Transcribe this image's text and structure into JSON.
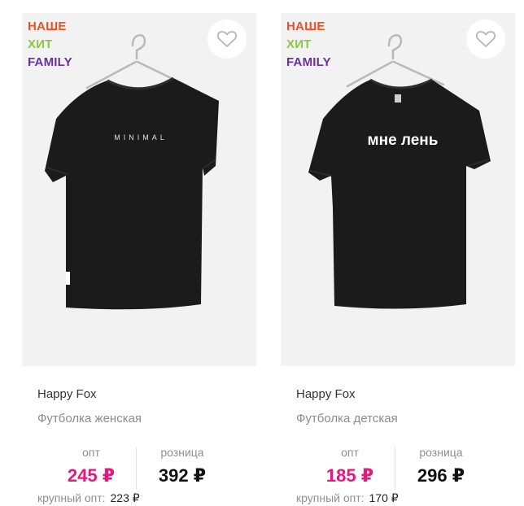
{
  "products": [
    {
      "badges": [
        {
          "text": "НАШЕ",
          "color": "#f04e23"
        },
        {
          "text": "ХИТ",
          "color": "#8dc63f"
        },
        {
          "text": "FAMILY",
          "color": "#6b2fa0"
        }
      ],
      "print_text": "MINIMAL",
      "brand": "Happy Fox",
      "title": "Футболка женская",
      "opt_label": "опт",
      "opt_price": "245 ₽",
      "retail_label": "розница",
      "retail_price": "392 ₽",
      "bulk_label": "крупный опт:",
      "bulk_price": "223 ₽"
    },
    {
      "badges": [
        {
          "text": "НАШЕ",
          "color": "#f04e23"
        },
        {
          "text": "ХИТ",
          "color": "#8dc63f"
        },
        {
          "text": "FAMILY",
          "color": "#6b2fa0"
        }
      ],
      "print_text": "мне лень",
      "brand": "Happy Fox",
      "title": "Футболка детская",
      "opt_label": "опт",
      "opt_price": "185 ₽",
      "retail_label": "розница",
      "retail_price": "296 ₽",
      "bulk_label": "крупный опт:",
      "bulk_price": "170 ₽"
    }
  ],
  "colors": {
    "accent_price": "#e6177d",
    "image_bg": "#f2f2f2",
    "shirt": "#1b1b1b"
  },
  "icons": {
    "favorite": "heart-outline-icon",
    "hanger": "hanger-icon"
  }
}
